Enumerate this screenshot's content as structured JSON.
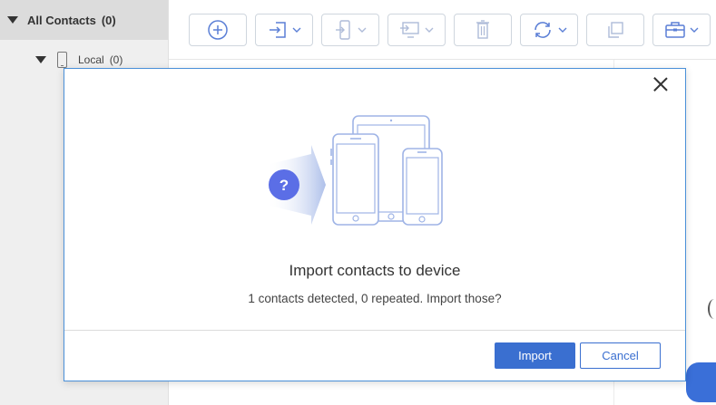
{
  "sidebar": {
    "root": {
      "label": "All Contacts",
      "count": "(0)"
    },
    "child": {
      "label": "Local",
      "count": "(0)"
    }
  },
  "toolbar": {
    "buttons": [
      {
        "icon": "plus-circle-icon"
      },
      {
        "icon": "import-icon",
        "has_menu": true
      },
      {
        "icon": "device-transfer-icon",
        "has_menu": true
      },
      {
        "icon": "computer-export-icon",
        "has_menu": true
      },
      {
        "icon": "trash-icon"
      },
      {
        "icon": "sync-icon",
        "has_menu": true
      },
      {
        "icon": "duplicate-icon"
      },
      {
        "icon": "toolbox-icon",
        "has_menu": true
      }
    ]
  },
  "dialog": {
    "title": "Import contacts to device",
    "message": "1 contacts detected, 0 repeated. Import those?",
    "question_mark": "?",
    "import_label": "Import",
    "cancel_label": "Cancel"
  },
  "colors": {
    "accent": "#3a6fd0",
    "dialog_border": "#4a90d9",
    "icon_blue": "#5b7fd6",
    "illustration_line": "#9fb4e6"
  }
}
